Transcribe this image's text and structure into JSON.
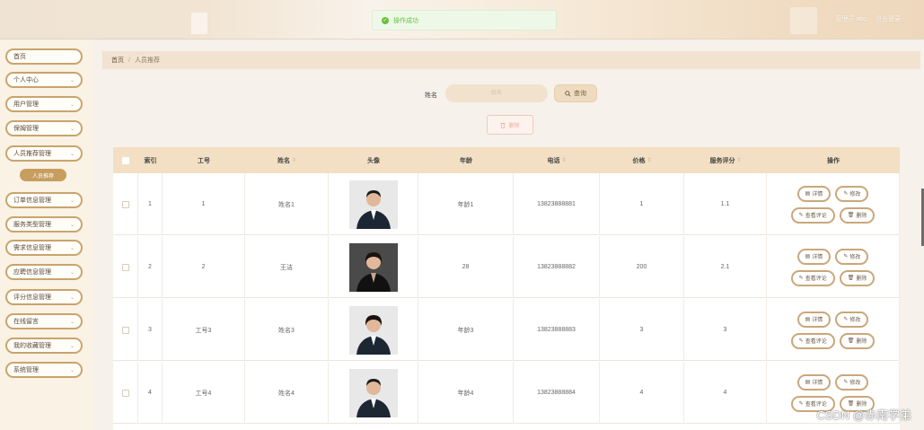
{
  "header": {
    "toast_text": "操作成功",
    "admin_label": "管理员 abo",
    "logout_label": "退出登录"
  },
  "sidebar": {
    "items": [
      {
        "label": "首页",
        "has_arrow": false
      },
      {
        "label": "个人中心",
        "has_arrow": true
      },
      {
        "label": "用户管理",
        "has_arrow": true
      },
      {
        "label": "保姆管理",
        "has_arrow": true
      },
      {
        "label": "人员推荐管理",
        "has_arrow": true
      },
      {
        "label": "订单信息管理",
        "has_arrow": true
      },
      {
        "label": "服务类型管理",
        "has_arrow": true
      },
      {
        "label": "需求信息管理",
        "has_arrow": true
      },
      {
        "label": "应聘信息管理",
        "has_arrow": true
      },
      {
        "label": "评分信息管理",
        "has_arrow": true
      },
      {
        "label": "在线留言",
        "has_arrow": true
      },
      {
        "label": "我的收藏管理",
        "has_arrow": true
      },
      {
        "label": "系统管理",
        "has_arrow": true
      }
    ],
    "active_sub": "人员推荐"
  },
  "breadcrumb": {
    "home": "首页",
    "sep": "/",
    "current": "人员推荐"
  },
  "search": {
    "label": "姓名",
    "placeholder": "姓名",
    "query_label": "查询",
    "delete_label": "删除"
  },
  "table": {
    "columns": [
      "索引",
      "工号",
      "姓名",
      "头像",
      "年龄",
      "电话",
      "价格",
      "服务评分",
      "操作"
    ],
    "rows": [
      {
        "index": "1",
        "job_no": "1",
        "name": "姓名1",
        "age": "年龄1",
        "phone": "13823888881",
        "price": "1",
        "score": "1.1",
        "avatar": "man-suit"
      },
      {
        "index": "2",
        "job_no": "2",
        "name": "王洁",
        "age": "28",
        "phone": "13823888882",
        "price": "200",
        "score": "2.1",
        "avatar": "woman-black"
      },
      {
        "index": "3",
        "job_no": "工号3",
        "name": "姓名3",
        "age": "年龄3",
        "phone": "13823888883",
        "price": "3",
        "score": "3",
        "avatar": "woman-suit"
      },
      {
        "index": "4",
        "job_no": "工号4",
        "name": "姓名4",
        "age": "年龄4",
        "phone": "13823888884",
        "price": "4",
        "score": "4",
        "avatar": "man-suit"
      }
    ],
    "actions": {
      "detail": "详情",
      "edit": "修改",
      "comments": "查看评论",
      "delete": "删除"
    }
  },
  "watermark": "CSDN @赤南学弟",
  "colors": {
    "accent": "#c9a46d",
    "active_sub": "#c79e5f",
    "header_row": "#f3dfc3",
    "success": "#67c23a"
  }
}
